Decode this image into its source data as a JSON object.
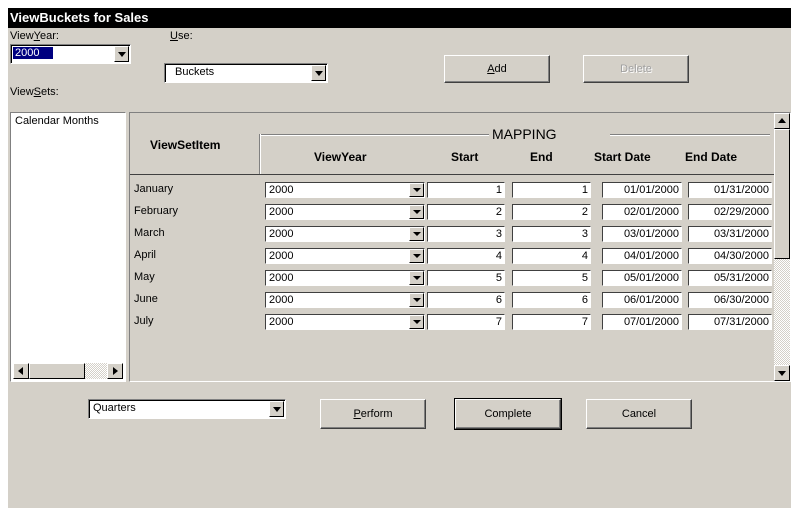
{
  "window": {
    "title": "ViewBuckets for Sales"
  },
  "top": {
    "viewyear_label_pre": "View",
    "viewyear_label_u": "Y",
    "viewyear_label_post": "ear:",
    "use_label_u": "U",
    "use_label_post": "se:",
    "viewyear_value": "2000",
    "use_value": "Buckets",
    "add_u": "A",
    "add_post": "dd",
    "delete_label": "Delete",
    "viewsets_label_pre": "View",
    "viewsets_label_u": "S",
    "viewsets_label_post": "ets:"
  },
  "viewsets": {
    "items": [
      "Calendar Months"
    ]
  },
  "grid": {
    "headers": {
      "item": "ViewSetItem",
      "mapping": "MAPPING",
      "viewyear": "ViewYear",
      "start": "Start",
      "end": "End",
      "start_date": "Start Date",
      "end_date": "End Date"
    },
    "rows": [
      {
        "name": "January",
        "year": "2000",
        "start": "1",
        "end": "1",
        "start_date": "01/01/2000",
        "end_date": "01/31/2000"
      },
      {
        "name": "February",
        "year": "2000",
        "start": "2",
        "end": "2",
        "start_date": "02/01/2000",
        "end_date": "02/29/2000"
      },
      {
        "name": "March",
        "year": "2000",
        "start": "3",
        "end": "3",
        "start_date": "03/01/2000",
        "end_date": "03/31/2000"
      },
      {
        "name": "April",
        "year": "2000",
        "start": "4",
        "end": "4",
        "start_date": "04/01/2000",
        "end_date": "04/30/2000"
      },
      {
        "name": "May",
        "year": "2000",
        "start": "5",
        "end": "5",
        "start_date": "05/01/2000",
        "end_date": "05/31/2000"
      },
      {
        "name": "June",
        "year": "2000",
        "start": "6",
        "end": "6",
        "start_date": "06/01/2000",
        "end_date": "06/30/2000"
      },
      {
        "name": "July",
        "year": "2000",
        "start": "7",
        "end": "7",
        "start_date": "07/01/2000",
        "end_date": "07/31/2000"
      }
    ]
  },
  "bottom": {
    "combo_value": "Quarters",
    "perform_u": "P",
    "perform_post": "erform",
    "complete_label": "Complete",
    "cancel_label": "Cancel"
  },
  "icons": [
    "chevron-down-icon",
    "arrow-left-icon",
    "arrow-right-icon",
    "arrow-up-icon",
    "arrow-down-icon"
  ]
}
